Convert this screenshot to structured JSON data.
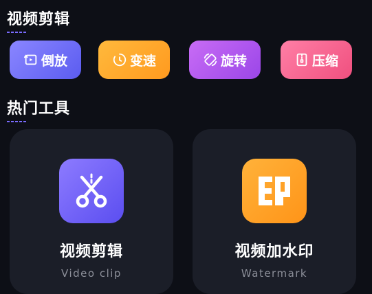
{
  "sections": {
    "video_edit_title": "视频剪辑",
    "hot_tools_title": "热门工具"
  },
  "quick_actions": [
    {
      "label": "倒放",
      "icon": "reverse-play-icon",
      "color": "#6f6cf7"
    },
    {
      "label": "变速",
      "icon": "speed-timer-icon",
      "color": "#ffa62a"
    },
    {
      "label": "旋转",
      "icon": "rotate-icon",
      "color": "#b359ee"
    },
    {
      "label": "压缩",
      "icon": "compress-icon",
      "color": "#f8678f"
    }
  ],
  "tools": [
    {
      "title": "视频剪辑",
      "subtitle": "Video clip",
      "icon": "scissors-icon",
      "color": "#7264f7"
    },
    {
      "title": "视频加水印",
      "subtitle": "Watermark",
      "icon": "watermark-stamp-icon",
      "color": "#ffa326"
    }
  ]
}
